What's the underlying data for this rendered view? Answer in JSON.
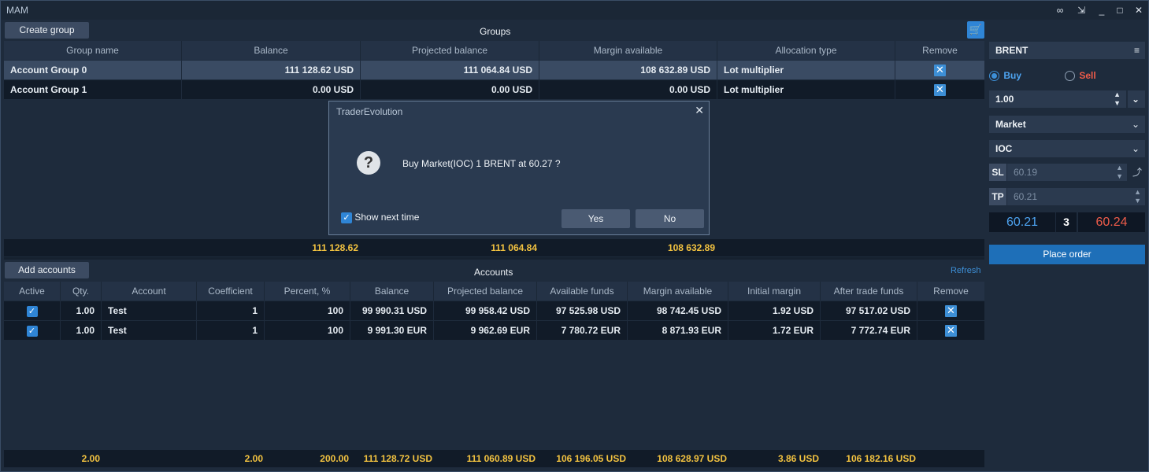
{
  "window": {
    "title": "MAM"
  },
  "groups": {
    "create_button": "Create group",
    "title": "Groups",
    "columns": [
      "Group name",
      "Balance",
      "Projected balance",
      "Margin available",
      "Allocation type",
      "Remove"
    ],
    "rows": [
      {
        "name": "Account Group 0",
        "balance": "111 128.62 USD",
        "projected": "111 064.84 USD",
        "margin": "108 632.89 USD",
        "allocation": "Lot multiplier"
      },
      {
        "name": "Account Group 1",
        "balance": "0.00 USD",
        "projected": "0.00 USD",
        "margin": "0.00 USD",
        "allocation": "Lot multiplier"
      }
    ],
    "totals": {
      "balance": "111 128.62",
      "projected": "111 064.84",
      "margin": "108 632.89"
    }
  },
  "dialog": {
    "title": "TraderEvolution",
    "message": "Buy Market(IOC) 1 BRENT at 60.27  ?",
    "show_next": "Show next time",
    "yes": "Yes",
    "no": "No"
  },
  "accounts": {
    "add_button": "Add accounts",
    "title": "Accounts",
    "refresh": "Refresh",
    "columns": [
      "Active",
      "Qty.",
      "Account",
      "Coefficient",
      "Percent, %",
      "Balance",
      "Projected balance",
      "Available funds",
      "Margin available",
      "Initial margin",
      "After trade funds",
      "Remove"
    ],
    "rows": [
      {
        "qty": "1.00",
        "account": "Test",
        "coef": "1",
        "percent": "100",
        "balance": "99 990.31 USD",
        "projected": "99 958.42 USD",
        "available": "97 525.98 USD",
        "margin": "98 742.45 USD",
        "initial": "1.92 USD",
        "after": "97 517.02 USD"
      },
      {
        "qty": "1.00",
        "account": "Test",
        "coef": "1",
        "percent": "100",
        "balance": "9 991.30 EUR",
        "projected": "9 962.69 EUR",
        "available": "7 780.72 EUR",
        "margin": "8 871.93 EUR",
        "initial": "1.72 EUR",
        "after": "7 772.74 EUR"
      }
    ],
    "totals": {
      "qty": "2.00",
      "coef": "2.00",
      "percent": "200.00",
      "balance": "111 128.72 USD",
      "projected": "111 060.89 USD",
      "available": "106 196.05 USD",
      "margin": "108 628.97 USD",
      "initial": "3.86 USD",
      "after": "106 182.16 USD"
    }
  },
  "order": {
    "symbol": "BRENT",
    "buy": "Buy",
    "sell": "Sell",
    "quantity": "1.00",
    "order_type": "Market",
    "tif": "IOC",
    "sl_label": "SL",
    "sl_value": "60.19",
    "tp_label": "TP",
    "tp_value": "60.21",
    "bid": "60.21",
    "spread": "3",
    "ask": "60.24",
    "place": "Place order"
  },
  "colors": {
    "accent": "#3d8fd6",
    "total": "#f2c240",
    "bid": "#4da3f0",
    "ask": "#ef5c4a",
    "sell": "#ef5c4a"
  }
}
